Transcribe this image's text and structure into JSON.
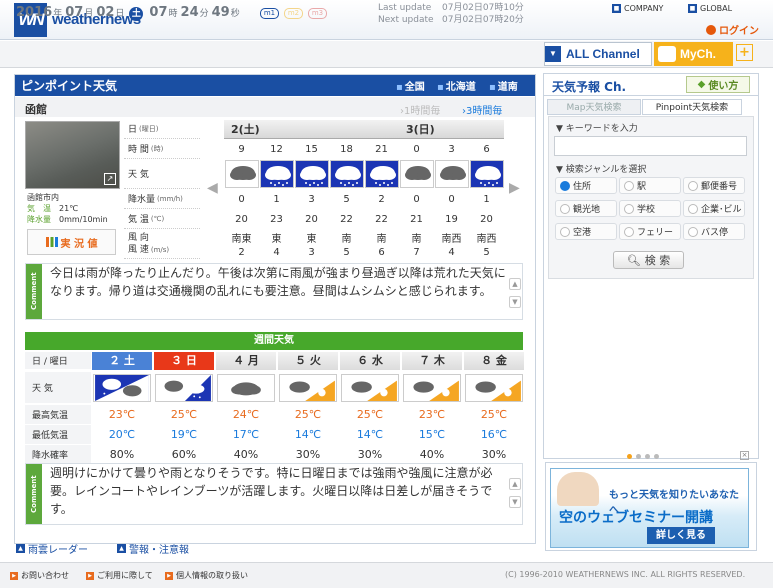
{
  "header": {
    "logo": "WN",
    "brand": "weathernews",
    "company": "COMPANY",
    "global": "GLOBAL",
    "login": "ログイン"
  },
  "clock": {
    "year": "2016",
    "m": "07",
    "d": "02",
    "dow": "土",
    "hh": "07",
    "mm": "24",
    "ss": "49",
    "y_unit": "年",
    "m_unit": "月",
    "d_unit": "日",
    "h_unit": "時",
    "min_unit": "分",
    "s_unit": "秒",
    "m1": "m1",
    "m2": "m2",
    "m3": "m3"
  },
  "update": {
    "last_label": "Last update",
    "last": "07月02日07時10分",
    "next_label": "Next update",
    "next": "07月02日07時20分"
  },
  "channels": {
    "all": "ALL Channel",
    "my": "MyCh.",
    "plus": "+"
  },
  "pinpoint": {
    "title": "ピンポイント天気",
    "regions": [
      "全国",
      "北海道",
      "道南"
    ],
    "city": "函館",
    "btn1": "1時間毎",
    "btn3": "3時間毎"
  },
  "camera": {
    "place": "函館市内",
    "temp_label": "気　温",
    "temp": "21℃",
    "rain_label": "降水量",
    "rain": "0mm/10min",
    "jikkyo": "実 況 値"
  },
  "rows": {
    "day": "日",
    "day_u": "(曜日)",
    "time": "時 間",
    "time_u": "(時)",
    "weather": "天 気",
    "precip": "降水量",
    "precip_u": "(mm/h)",
    "temp": "気 温",
    "temp_u": "(℃)",
    "wind1": "風 向",
    "wind2": "風 速",
    "wind_u": "(m/s)"
  },
  "days": {
    "d1": "2(土)",
    "d2": "3(日)"
  },
  "hourly": {
    "times": [
      "9",
      "12",
      "15",
      "18",
      "21",
      "0",
      "3",
      "6"
    ],
    "weather": [
      "cloud",
      "rain",
      "rain",
      "rain",
      "rain",
      "cloud",
      "cloud",
      "rain"
    ],
    "precip": [
      "0",
      "1",
      "3",
      "5",
      "2",
      "0",
      "0",
      "1"
    ],
    "temp": [
      "20",
      "23",
      "20",
      "22",
      "22",
      "21",
      "19",
      "20"
    ],
    "wdir": [
      "南東",
      "東",
      "東",
      "南",
      "南",
      "南",
      "南西",
      "南西"
    ],
    "wspd": [
      "2",
      "4",
      "3",
      "5",
      "6",
      "7",
      "4",
      "5"
    ]
  },
  "comment1": {
    "tab": "Comment",
    "text": "今日は雨が降ったり止んだり。午後は次第に雨風が強まり昼過ぎ以降は荒れた天気になります。帰り道は交通機関の乱れにも要注意。昼間はムシムシと感じられます。"
  },
  "weekly": {
    "title": "週間天気",
    "label_day": "日 / 曜日",
    "label_wx": "天 気",
    "label_hi": "最高気温",
    "label_lo": "最低気温",
    "label_pop": "降水確率",
    "days": [
      "２ 土",
      "３ 日",
      "４ 月",
      "５ 火",
      "６ 水",
      "７ 木",
      "８ 金"
    ],
    "icons": [
      "rain-cloud",
      "cloud-rain",
      "cloud",
      "cloud-sun",
      "cloud-sun",
      "cloud-sun",
      "cloud-sun"
    ],
    "hi": [
      "23℃",
      "25℃",
      "24℃",
      "25℃",
      "25℃",
      "23℃",
      "25℃"
    ],
    "lo": [
      "20℃",
      "19℃",
      "17℃",
      "14℃",
      "14℃",
      "15℃",
      "16℃"
    ],
    "pop": [
      "80%",
      "60%",
      "40%",
      "30%",
      "30%",
      "40%",
      "30%"
    ],
    "colors": {
      "hi": "#e86b1e",
      "lo": "#1a7bdc"
    }
  },
  "comment2": {
    "tab": "Comment",
    "text": "週明けにかけて曇りや雨となりそうです。特に日曜日までは強雨や強風に注意が必要。レインコートやレインブーツが活躍します。火曜日以降は日差しが届きそうです。"
  },
  "legend": {
    "radar": "雨雲レーダー",
    "warn": "警報・注意報"
  },
  "right": {
    "title": "天気予報 Ch.",
    "howto": "使い方",
    "tab1": "Map天気検索",
    "tab2": "Pinpoint天気検索",
    "kw_label": "▼ キーワードを入力",
    "genre_label": "▼ 検索ジャンルを選択",
    "opts": [
      "住所",
      "駅",
      "郵便番号",
      "観光地",
      "学校",
      "企業･ビル",
      "空港",
      "フェリー",
      "バス停"
    ],
    "search": "検 索"
  },
  "ad": {
    "line1": "もっと天気を知りたいあなたへ",
    "line2": "空のウェブセミナー開講",
    "btn": "詳しく見る"
  },
  "footer": {
    "contact": "お問い合わせ",
    "terms": "ご利用に際して",
    "privacy": "個人情報の取り扱い",
    "copyright": "(C) 1996-2010 WEATHERNEWS INC. ALL RIGHTS RESERVED."
  },
  "colors": {
    "brand": "#1a4fa3",
    "green": "#47a82b",
    "orange": "#e86b1e",
    "rain": "#1c35b4"
  }
}
